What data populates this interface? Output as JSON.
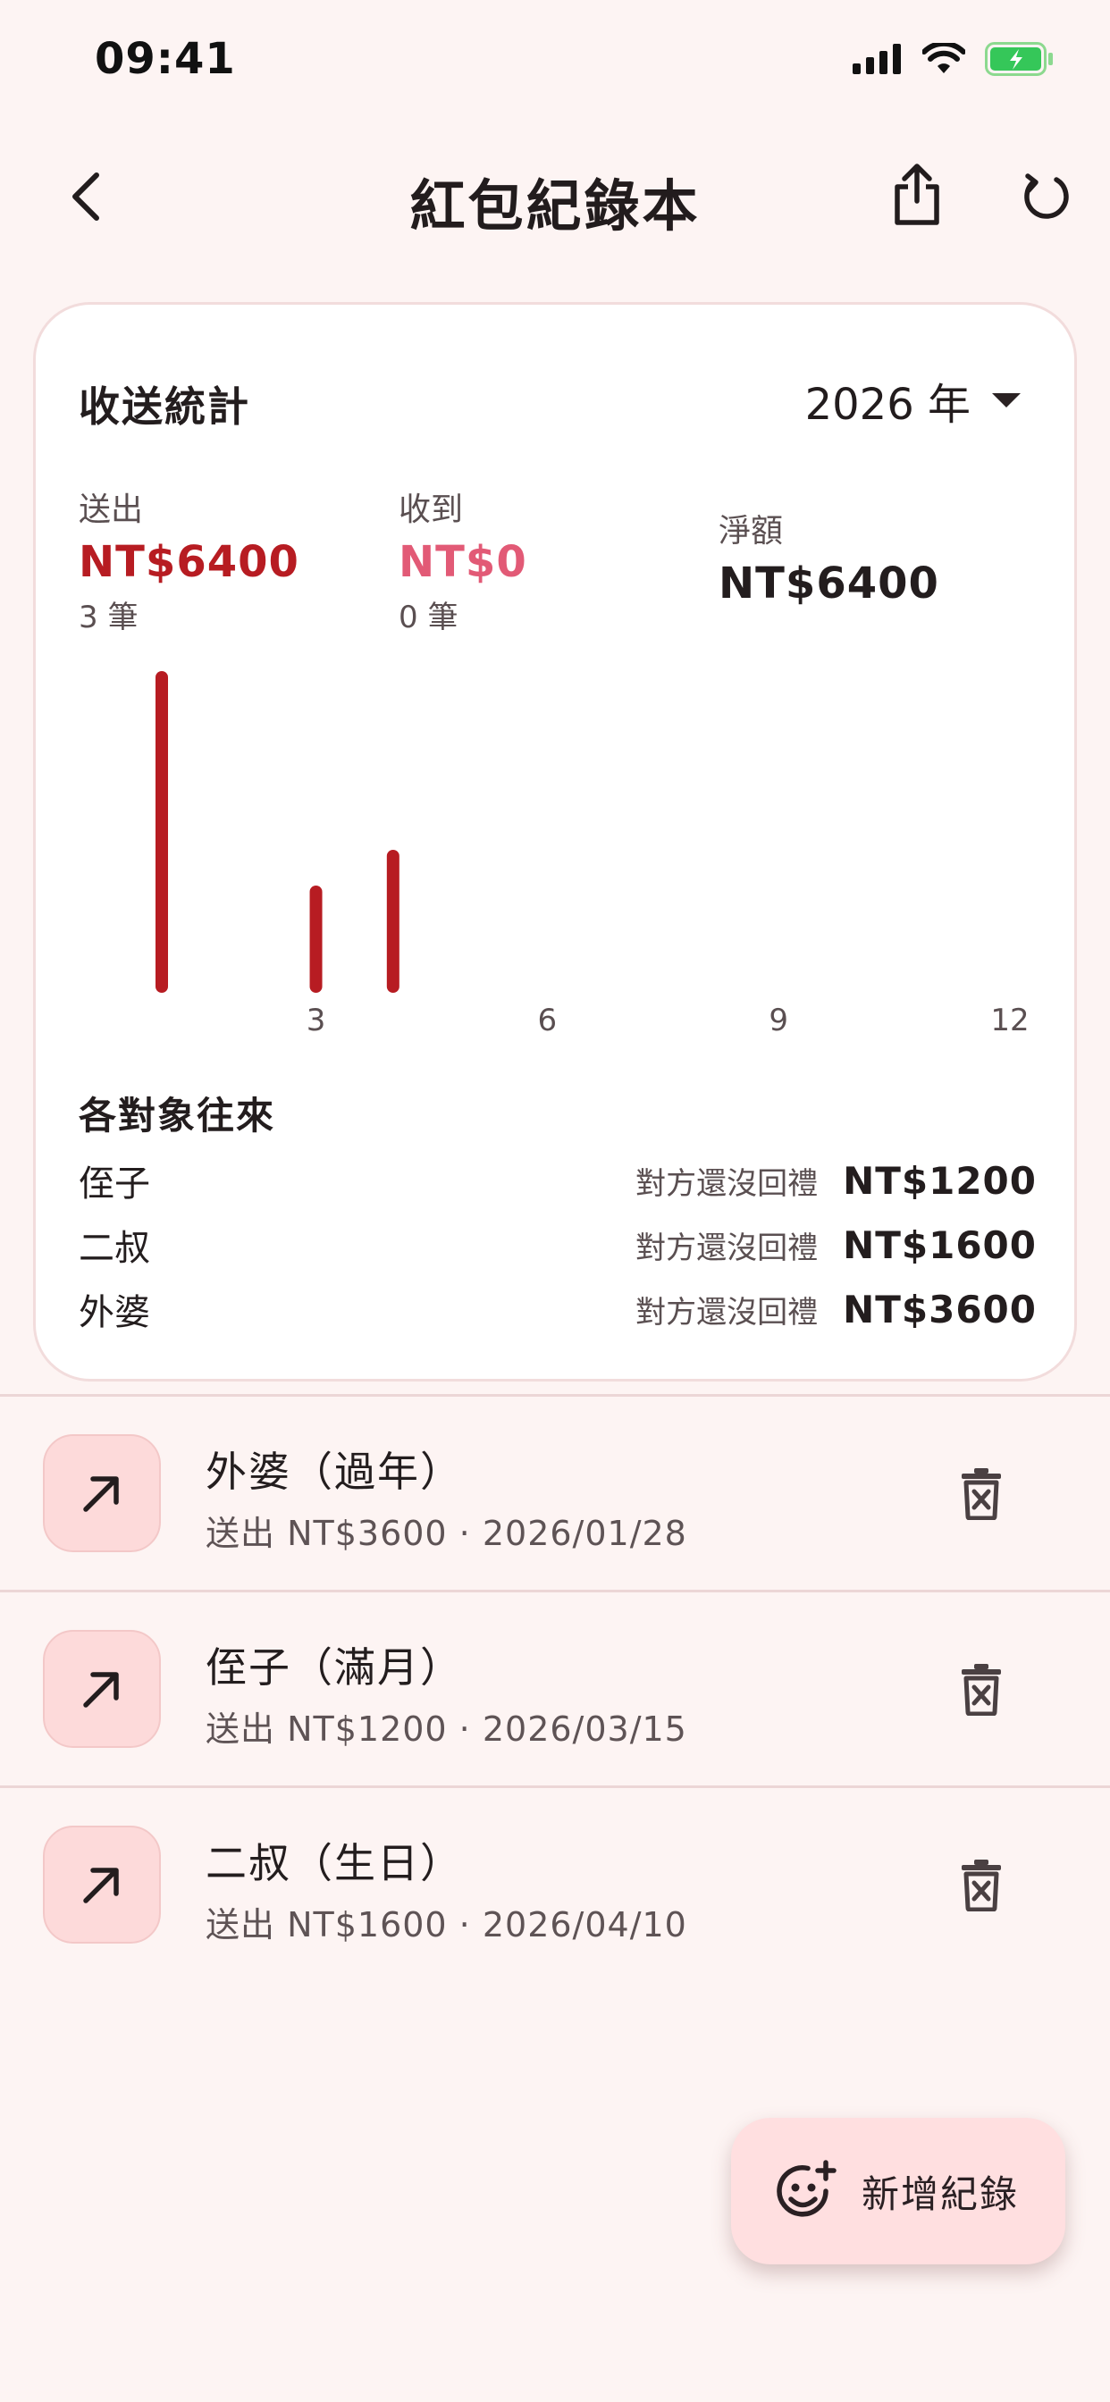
{
  "status_bar": {
    "time": "09:41",
    "icons": [
      "signal-icon",
      "wifi-icon",
      "battery-charging-icon"
    ]
  },
  "app_bar": {
    "title": "紅包紀錄本",
    "icons": [
      "back-arrow-icon",
      "share-icon",
      "refresh-icon"
    ]
  },
  "stats": {
    "title": "收送統計",
    "year": "2026 年",
    "sent": {
      "label": "送出",
      "value": "NT$6400",
      "count": "3 筆"
    },
    "received": {
      "label": "收到",
      "value": "NT$0",
      "count": "0 筆"
    },
    "net": {
      "label": "淨額",
      "value": "NT$6400"
    }
  },
  "chart_data": {
    "type": "bar",
    "x": [
      1,
      3,
      4
    ],
    "values": [
      3600,
      1200,
      1600
    ],
    "xlim": [
      1,
      12
    ],
    "ylim": [
      0,
      3600
    ],
    "x_ticks": [
      "3",
      "6",
      "9",
      "12"
    ],
    "grid": false,
    "legend": "none",
    "color": "#b71c22"
  },
  "relations": {
    "title": "各對象往來",
    "items": [
      {
        "name": "侄子",
        "status": "對方還沒回禮",
        "amount": "NT$1200"
      },
      {
        "name": "二叔",
        "status": "對方還沒回禮",
        "amount": "NT$1600"
      },
      {
        "name": "外婆",
        "status": "對方還沒回禮",
        "amount": "NT$3600"
      }
    ]
  },
  "records": [
    {
      "title": "外婆（過年）",
      "subtitle": "送出 NT$3600 · 2026/01/28",
      "icon": "arrow-up-right-icon"
    },
    {
      "title": "侄子（滿月）",
      "subtitle": "送出 NT$1200 · 2026/03/15",
      "icon": "arrow-up-right-icon"
    },
    {
      "title": "二叔（生日）",
      "subtitle": "送出 NT$1600 · 2026/04/10",
      "icon": "arrow-up-right-icon"
    }
  ],
  "fab": {
    "label": "新增紀錄",
    "icon": "add-emoji-icon"
  },
  "colors": {
    "background": "#fdf4f3",
    "sent": "#b71c22",
    "received": "#e25a76",
    "icon_tile": "#fddada",
    "fab": "#ffdfe0"
  }
}
